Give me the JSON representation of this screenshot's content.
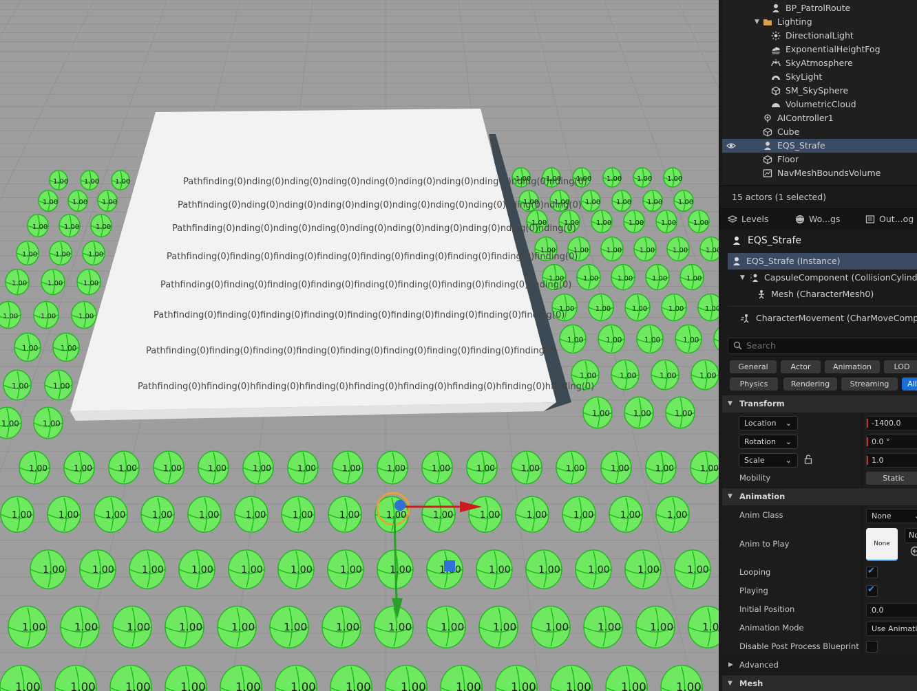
{
  "outliner": {
    "items": [
      {
        "label": "BP_PatrolRoute",
        "icon": "pawn-icon"
      },
      {
        "label": "Lighting",
        "icon": "folder-icon"
      },
      {
        "label": "DirectionalLight",
        "icon": "directional-light-icon"
      },
      {
        "label": "ExponentialHeightFog",
        "icon": "fog-icon"
      },
      {
        "label": "SkyAtmosphere",
        "icon": "sky-atmosphere-icon"
      },
      {
        "label": "SkyLight",
        "icon": "skylight-icon"
      },
      {
        "label": "SM_SkySphere",
        "icon": "static-mesh-icon"
      },
      {
        "label": "VolumetricCloud",
        "icon": "cloud-icon"
      },
      {
        "label": "AIController1",
        "icon": "ai-controller-icon"
      },
      {
        "label": "Cube",
        "icon": "static-mesh-icon"
      },
      {
        "label": "EQS_Strafe",
        "icon": "pawn-icon"
      },
      {
        "label": "Floor",
        "icon": "static-mesh-icon"
      },
      {
        "label": "NavMeshBoundsVolume",
        "icon": "volume-icon"
      }
    ],
    "selected": "EQS_Strafe",
    "actor_count": "15 actors (1 selected)"
  },
  "tabs": [
    {
      "label": "Levels",
      "icon": "levels-icon"
    },
    {
      "label": "Wo...gs",
      "icon": "world-settings-icon"
    },
    {
      "label": "Out...og",
      "icon": "output-log-icon"
    }
  ],
  "details": {
    "actor_name": "EQS_Strafe",
    "components": [
      {
        "label": "EQS_Strafe (Instance)"
      },
      {
        "label": "CapsuleComponent (CollisionCylinder)"
      },
      {
        "label": "Mesh (CharacterMesh0)"
      },
      {
        "label": "CharacterMovement (CharMoveComp)"
      }
    ],
    "search_placeholder": "Search",
    "filters": [
      "General",
      "Actor",
      "Animation",
      "LOD",
      "Physics",
      "Rendering",
      "Streaming",
      "All"
    ],
    "active_filter": "All",
    "transform": {
      "section": "Transform",
      "location_label": "Location",
      "location_x": "-1400.0",
      "rotation_label": "Rotation",
      "rotation_x": "0.0 °",
      "scale_label": "Scale",
      "scale_x": "1.0",
      "mobility_label": "Mobility",
      "mobility_value": "Static"
    },
    "animation": {
      "section": "Animation",
      "anim_class_label": "Anim Class",
      "anim_class_value": "None",
      "anim_to_play_label": "Anim to Play",
      "anim_to_play_thumb": "None",
      "anim_to_play_value": "No",
      "looping_label": "Looping",
      "looping": true,
      "playing_label": "Playing",
      "playing": true,
      "initial_position_label": "Initial Position",
      "initial_position_value": "0.0",
      "animation_mode_label": "Animation Mode",
      "animation_mode_value": "Use Animation",
      "disable_pp_label": "Disable Post Process Blueprint",
      "disable_pp": false
    },
    "advanced_label": "Advanced",
    "mesh_section": "Mesh"
  },
  "viewport": {
    "wall_text": "Pathfinding(0)",
    "wall_row_texts": [
      "Pathfinding(0)nding(0)nding(0)nding(0)nding(0)nding(0)nding(0)nding(0)nding(0)nding(0)",
      "Pathfinding(0)nding(0)nding(0)nding(0)nding(0)nding(0)nding(0)nding(0)nding(0)nding(0)",
      "Pathfinding(0)nding(0)nding(0)nding(0)nding(0)nding(0)nding(0)nding(0)nding(0)nding(0)",
      "Pathfinding(0)finding(0)finding(0)finding(0)finding(0)finding(0)finding(0)finding(0)finding(0)",
      "Pathfinding(0)finding(0)finding(0)finding(0)finding(0)finding(0)finding(0)finding(0)finding(0)",
      "Pathfinding(0)finding(0)finding(0)finding(0)finding(0)finding(0)finding(0)finding(0)finding(0)",
      "Pathfinding(0)finding(0)finding(0)finding(0)finding(0)finding(0)finding(0)finding(0)finding(0)",
      "Pathfinding(0)hfinding(0)hfinding(0)hfinding(0)hfinding(0)hfinding(0)hfinding(0)hfinding(0)hfinding(0)"
    ],
    "score_label": "1.00",
    "colors": {
      "sphere": "#6cf05a",
      "sphere_stroke": "#1bb81b",
      "floor": "#9e9e9e",
      "grid": "#8a8a8a",
      "wall": "#f2f2f2",
      "wall_shadow": "#3c4a55"
    }
  }
}
